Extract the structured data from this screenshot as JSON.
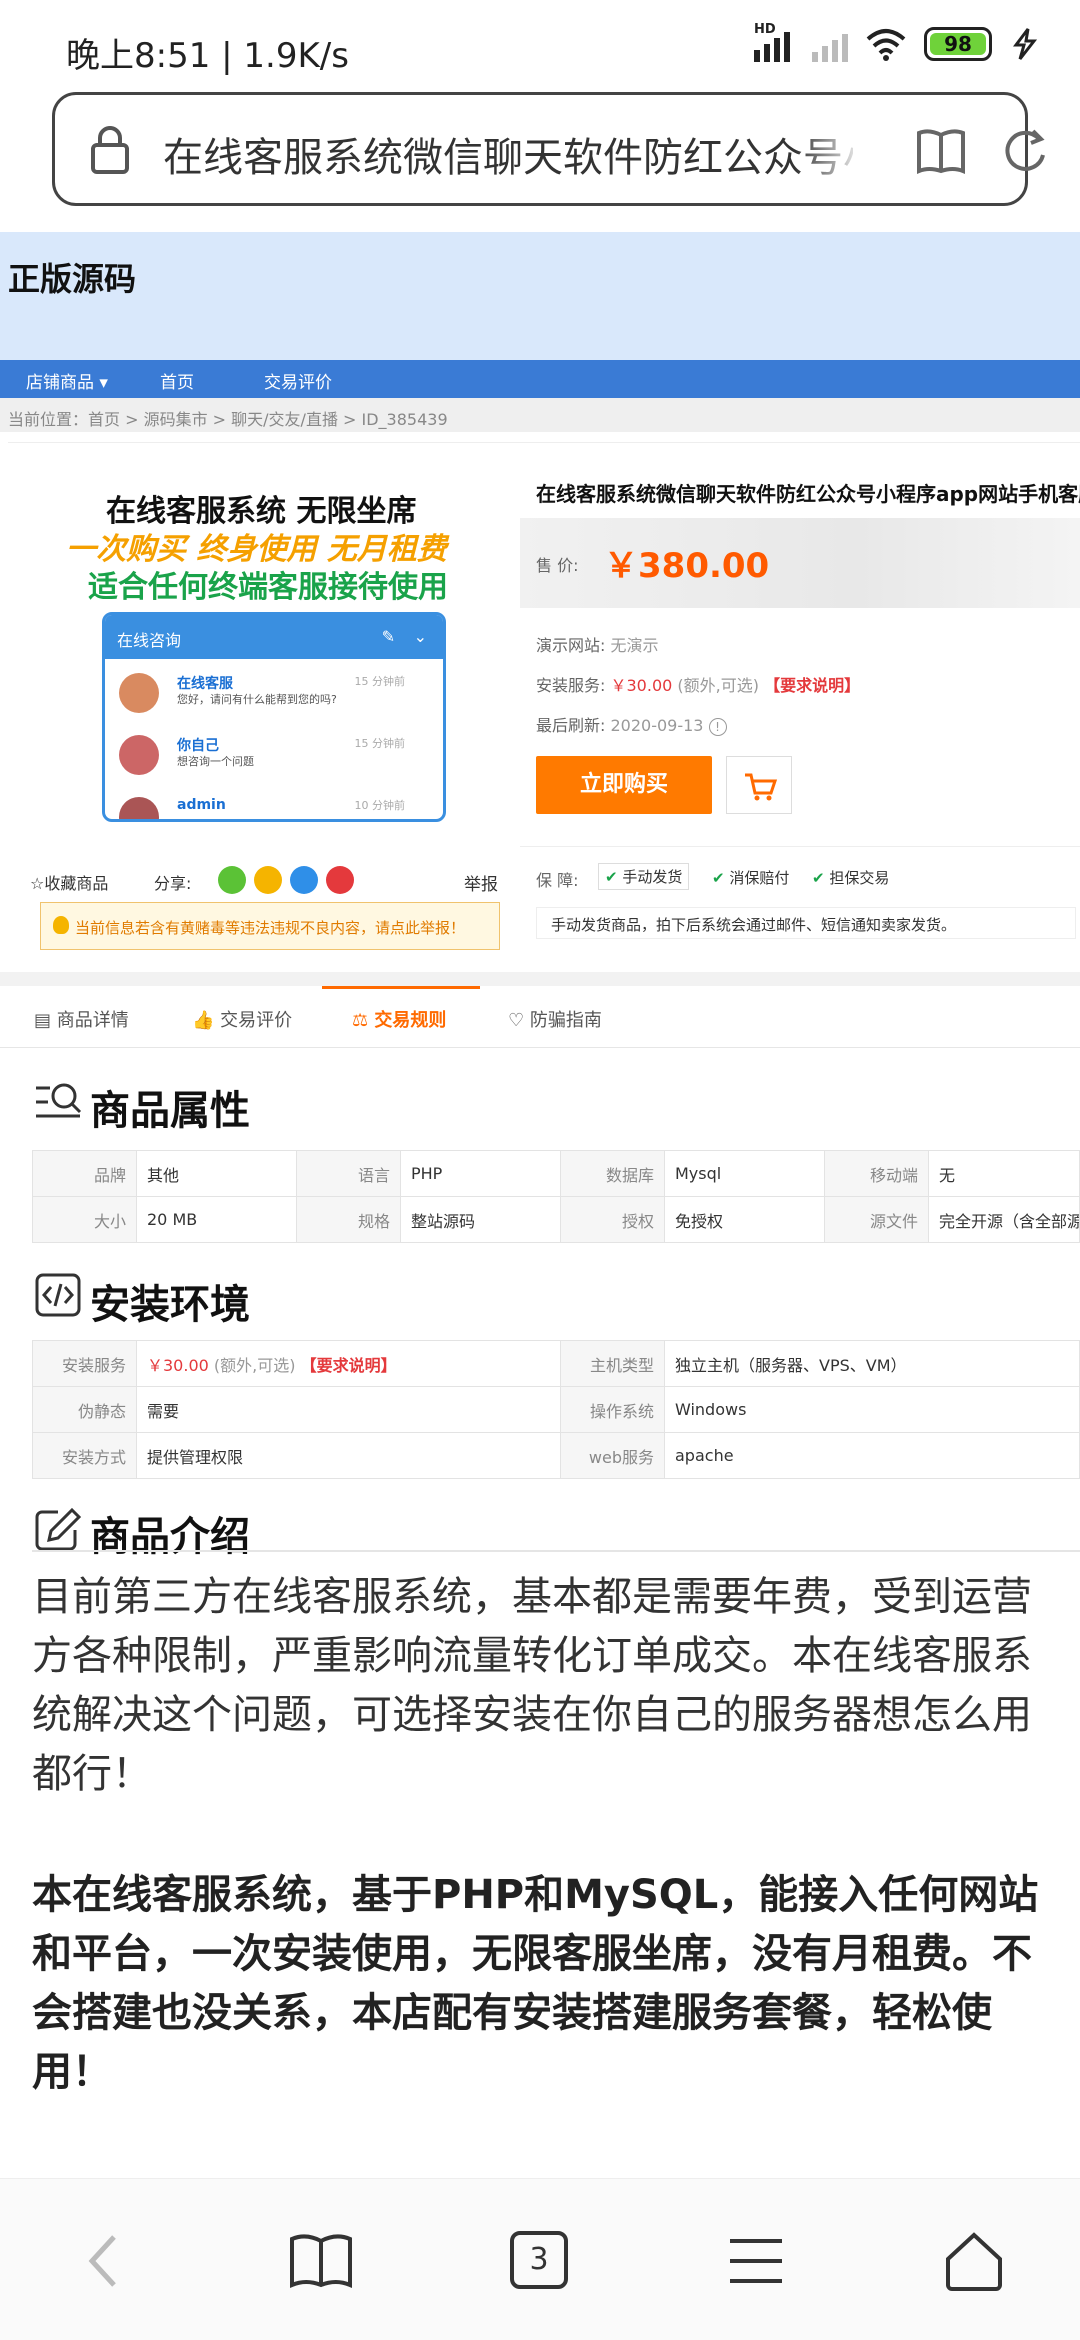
{
  "status_bar": {
    "time": "晚上8:51 | 1.9K/s",
    "signal_label": "HD",
    "battery": "98"
  },
  "url_bar": {
    "text": "在线客服系统微信聊天软件防红公众号小程序app网站手机"
  },
  "shop": {
    "title": "正版源码",
    "nav": [
      "店铺商品 ▾",
      "首页",
      "交易评价"
    ],
    "breadcrumb": "当前位置：首页 > 源码集市 > 聊天/交友/直播 > ID_385439"
  },
  "product_image": {
    "line1": "在线客服系统 无限坐席",
    "line2": "一次购买 终身使用 无月租费",
    "line3": "适合任何终端客服接待使用",
    "chat_title": "在线咨询",
    "messages": [
      {
        "name": "在线客服",
        "text": "您好，请问有什么能帮到您的吗?",
        "time": "15 分钟前"
      },
      {
        "name": "你自己",
        "text": "想咨询一个问题",
        "time": "15 分钟前"
      },
      {
        "name": "admin",
        "text": "",
        "time": "10 分钟前"
      }
    ]
  },
  "actions": {
    "favorite": "☆收藏商品",
    "share": "分享:",
    "report": "举报",
    "warning": "当前信息若含有黄赌毒等违法违规不良内容，请点此举报！"
  },
  "product": {
    "title": "在线客服系统微信聊天软件防红公众号小程序app网站手机客服",
    "price_label": "售 价:",
    "price": "￥380.00",
    "demo_label": "演示网站:",
    "demo_value": "无演示",
    "install_label": "安装服务:",
    "install_price": "￥30.00",
    "install_note": "(额外,可选)",
    "install_link": "【要求说明】",
    "refresh_label": "最后刷新:",
    "refresh_value": "2020-09-13",
    "buy_button": "立即购买",
    "guarantee_label": "保 障:",
    "guarantees": [
      "手动发货",
      "消保赔付",
      "担保交易"
    ],
    "guarantee_note": "手动发货商品，拍下后系统会通过邮件、短信通知卖家发货。"
  },
  "tabs": [
    "商品详情",
    "交易评价",
    "交易规则",
    "防骗指南"
  ],
  "attributes": {
    "title": "商品属性",
    "rows": [
      [
        [
          "品牌",
          "其他"
        ],
        [
          "语言",
          "PHP"
        ],
        [
          "数据库",
          "Mysql"
        ],
        [
          "移动端",
          "无"
        ]
      ],
      [
        [
          "大小",
          "20 MB"
        ],
        [
          "规格",
          "整站源码"
        ],
        [
          "授权",
          "免授权"
        ],
        [
          "源文件",
          "完全开源（含全部源文件）"
        ]
      ]
    ]
  },
  "environment": {
    "title": "安装环境",
    "install_label": "安装服务",
    "install_price": "￥30.00",
    "install_note": "(额外,可选)",
    "install_link": "【要求说明】",
    "host_label": "主机类型",
    "host_value": "独立主机（服务器、VPS、VM）",
    "static_label": "伪静态",
    "static_value": "需要",
    "os_label": "操作系统",
    "os_value": "Windows",
    "method_label": "安装方式",
    "method_value": "提供管理权限",
    "web_label": "web服务",
    "web_value": "apache"
  },
  "intro": {
    "title": "商品介绍",
    "para1": [
      "目前第三方在线客服系统，基本都是需要年费，受到运营",
      "方各种限制，严重影响流量转化订单成交。本在线客服系",
      "统解决这个问题，可选择安装在你自己的服务器想怎么用",
      "都行！"
    ],
    "para2": [
      "本在线客服系统，基于PHP和MySQL，能接入任何网站",
      "和平台，一次安装使用，无限客服坐席，没有月租费。不",
      "会搭建也没关系，本店配有安装搭建服务套餐，轻松使",
      "用！"
    ]
  },
  "bottom_bar": {
    "tab_count": "3"
  }
}
